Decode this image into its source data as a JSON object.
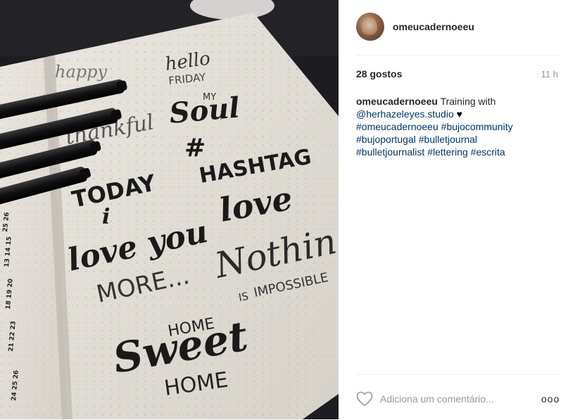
{
  "post": {
    "username": "omeucadernoeeu",
    "likes": "28 gostos",
    "time": "11 h",
    "caption": {
      "username": "omeucadernoeeu",
      "text": "Training with",
      "mention": "@herhazeleyes.studio",
      "heart": "♥",
      "tags": [
        "#omeucadernoeeu",
        "#bujocommunity",
        "#bujoportugal",
        "#bulletjournal",
        "#bulletjournalist",
        "#lettering",
        "#escrita"
      ]
    }
  },
  "photo": {
    "lettering": {
      "happy": "happy",
      "hello": "hello",
      "friday": "FRIDAY",
      "my": "MY",
      "soul": "Soul",
      "thankful": "thankful",
      "hash": "#",
      "hashtag": "HASHTAG",
      "today": "TODAY",
      "i": "i",
      "love_right": "love",
      "love_you": "love you",
      "more": "MORE...",
      "nothing": "Nothing",
      "is": "IS",
      "impossible": "IMPOSSIBLE",
      "home_top": "HOME",
      "sweet": "Sweet",
      "home_bottom": "HOME"
    }
  },
  "footer": {
    "comment_placeholder": "Adiciona um comentário...",
    "more_label": "ooo"
  },
  "icons": {
    "like": "heart-outline-icon",
    "more": "more-options-icon"
  }
}
